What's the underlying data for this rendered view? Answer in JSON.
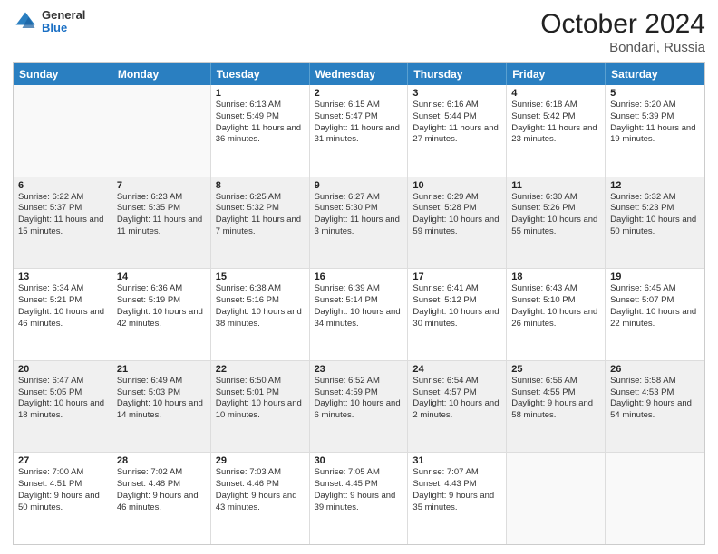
{
  "logo": {
    "line1": "General",
    "line2": "Blue"
  },
  "title": "October 2024",
  "subtitle": "Bondari, Russia",
  "days_of_week": [
    "Sunday",
    "Monday",
    "Tuesday",
    "Wednesday",
    "Thursday",
    "Friday",
    "Saturday"
  ],
  "weeks": [
    [
      {
        "day": "",
        "sunrise": "",
        "sunset": "",
        "daylight": "",
        "empty": true
      },
      {
        "day": "",
        "sunrise": "",
        "sunset": "",
        "daylight": "",
        "empty": true
      },
      {
        "day": "1",
        "sunrise": "Sunrise: 6:13 AM",
        "sunset": "Sunset: 5:49 PM",
        "daylight": "Daylight: 11 hours and 36 minutes."
      },
      {
        "day": "2",
        "sunrise": "Sunrise: 6:15 AM",
        "sunset": "Sunset: 5:47 PM",
        "daylight": "Daylight: 11 hours and 31 minutes."
      },
      {
        "day": "3",
        "sunrise": "Sunrise: 6:16 AM",
        "sunset": "Sunset: 5:44 PM",
        "daylight": "Daylight: 11 hours and 27 minutes."
      },
      {
        "day": "4",
        "sunrise": "Sunrise: 6:18 AM",
        "sunset": "Sunset: 5:42 PM",
        "daylight": "Daylight: 11 hours and 23 minutes."
      },
      {
        "day": "5",
        "sunrise": "Sunrise: 6:20 AM",
        "sunset": "Sunset: 5:39 PM",
        "daylight": "Daylight: 11 hours and 19 minutes."
      }
    ],
    [
      {
        "day": "6",
        "sunrise": "Sunrise: 6:22 AM",
        "sunset": "Sunset: 5:37 PM",
        "daylight": "Daylight: 11 hours and 15 minutes."
      },
      {
        "day": "7",
        "sunrise": "Sunrise: 6:23 AM",
        "sunset": "Sunset: 5:35 PM",
        "daylight": "Daylight: 11 hours and 11 minutes."
      },
      {
        "day": "8",
        "sunrise": "Sunrise: 6:25 AM",
        "sunset": "Sunset: 5:32 PM",
        "daylight": "Daylight: 11 hours and 7 minutes."
      },
      {
        "day": "9",
        "sunrise": "Sunrise: 6:27 AM",
        "sunset": "Sunset: 5:30 PM",
        "daylight": "Daylight: 11 hours and 3 minutes."
      },
      {
        "day": "10",
        "sunrise": "Sunrise: 6:29 AM",
        "sunset": "Sunset: 5:28 PM",
        "daylight": "Daylight: 10 hours and 59 minutes."
      },
      {
        "day": "11",
        "sunrise": "Sunrise: 6:30 AM",
        "sunset": "Sunset: 5:26 PM",
        "daylight": "Daylight: 10 hours and 55 minutes."
      },
      {
        "day": "12",
        "sunrise": "Sunrise: 6:32 AM",
        "sunset": "Sunset: 5:23 PM",
        "daylight": "Daylight: 10 hours and 50 minutes."
      }
    ],
    [
      {
        "day": "13",
        "sunrise": "Sunrise: 6:34 AM",
        "sunset": "Sunset: 5:21 PM",
        "daylight": "Daylight: 10 hours and 46 minutes."
      },
      {
        "day": "14",
        "sunrise": "Sunrise: 6:36 AM",
        "sunset": "Sunset: 5:19 PM",
        "daylight": "Daylight: 10 hours and 42 minutes."
      },
      {
        "day": "15",
        "sunrise": "Sunrise: 6:38 AM",
        "sunset": "Sunset: 5:16 PM",
        "daylight": "Daylight: 10 hours and 38 minutes."
      },
      {
        "day": "16",
        "sunrise": "Sunrise: 6:39 AM",
        "sunset": "Sunset: 5:14 PM",
        "daylight": "Daylight: 10 hours and 34 minutes."
      },
      {
        "day": "17",
        "sunrise": "Sunrise: 6:41 AM",
        "sunset": "Sunset: 5:12 PM",
        "daylight": "Daylight: 10 hours and 30 minutes."
      },
      {
        "day": "18",
        "sunrise": "Sunrise: 6:43 AM",
        "sunset": "Sunset: 5:10 PM",
        "daylight": "Daylight: 10 hours and 26 minutes."
      },
      {
        "day": "19",
        "sunrise": "Sunrise: 6:45 AM",
        "sunset": "Sunset: 5:07 PM",
        "daylight": "Daylight: 10 hours and 22 minutes."
      }
    ],
    [
      {
        "day": "20",
        "sunrise": "Sunrise: 6:47 AM",
        "sunset": "Sunset: 5:05 PM",
        "daylight": "Daylight: 10 hours and 18 minutes."
      },
      {
        "day": "21",
        "sunrise": "Sunrise: 6:49 AM",
        "sunset": "Sunset: 5:03 PM",
        "daylight": "Daylight: 10 hours and 14 minutes."
      },
      {
        "day": "22",
        "sunrise": "Sunrise: 6:50 AM",
        "sunset": "Sunset: 5:01 PM",
        "daylight": "Daylight: 10 hours and 10 minutes."
      },
      {
        "day": "23",
        "sunrise": "Sunrise: 6:52 AM",
        "sunset": "Sunset: 4:59 PM",
        "daylight": "Daylight: 10 hours and 6 minutes."
      },
      {
        "day": "24",
        "sunrise": "Sunrise: 6:54 AM",
        "sunset": "Sunset: 4:57 PM",
        "daylight": "Daylight: 10 hours and 2 minutes."
      },
      {
        "day": "25",
        "sunrise": "Sunrise: 6:56 AM",
        "sunset": "Sunset: 4:55 PM",
        "daylight": "Daylight: 9 hours and 58 minutes."
      },
      {
        "day": "26",
        "sunrise": "Sunrise: 6:58 AM",
        "sunset": "Sunset: 4:53 PM",
        "daylight": "Daylight: 9 hours and 54 minutes."
      }
    ],
    [
      {
        "day": "27",
        "sunrise": "Sunrise: 7:00 AM",
        "sunset": "Sunset: 4:51 PM",
        "daylight": "Daylight: 9 hours and 50 minutes."
      },
      {
        "day": "28",
        "sunrise": "Sunrise: 7:02 AM",
        "sunset": "Sunset: 4:48 PM",
        "daylight": "Daylight: 9 hours and 46 minutes."
      },
      {
        "day": "29",
        "sunrise": "Sunrise: 7:03 AM",
        "sunset": "Sunset: 4:46 PM",
        "daylight": "Daylight: 9 hours and 43 minutes."
      },
      {
        "day": "30",
        "sunrise": "Sunrise: 7:05 AM",
        "sunset": "Sunset: 4:45 PM",
        "daylight": "Daylight: 9 hours and 39 minutes."
      },
      {
        "day": "31",
        "sunrise": "Sunrise: 7:07 AM",
        "sunset": "Sunset: 4:43 PM",
        "daylight": "Daylight: 9 hours and 35 minutes."
      },
      {
        "day": "",
        "sunrise": "",
        "sunset": "",
        "daylight": "",
        "empty": true
      },
      {
        "day": "",
        "sunrise": "",
        "sunset": "",
        "daylight": "",
        "empty": true
      }
    ]
  ]
}
